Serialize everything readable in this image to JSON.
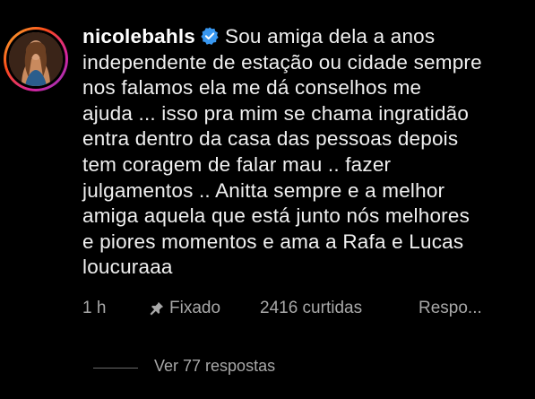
{
  "comment": {
    "username": "nicolebahls",
    "verified_icon": "verified-badge-icon",
    "text_lines": [
      "Sou amiga dela a anos",
      "independente de estação ou cidade sempre",
      "nos falamos ela me dá conselhos me",
      "ajuda ... isso pra mim se chama ingratidão",
      "entra dentro da casa das pessoas depois",
      "tem coragem de falar mau .. fazer",
      "julgamentos .. Anitta sempre e a melhor",
      "amiga aquela que está junto nós melhores",
      "e piores momentos e ama a Rafa e Lucas",
      "loucuraaa"
    ],
    "time": "1 h",
    "pinned_icon": "pin-icon",
    "pinned_label": "Fixado",
    "likes_label": "2416 curtidas",
    "reply_label": "Respo...",
    "view_replies_label": "Ver 77 respostas"
  },
  "colors": {
    "background": "#000000",
    "text": "#f0f0f0",
    "meta_text": "#a8a8a8",
    "verified_blue": "#3897f0"
  }
}
